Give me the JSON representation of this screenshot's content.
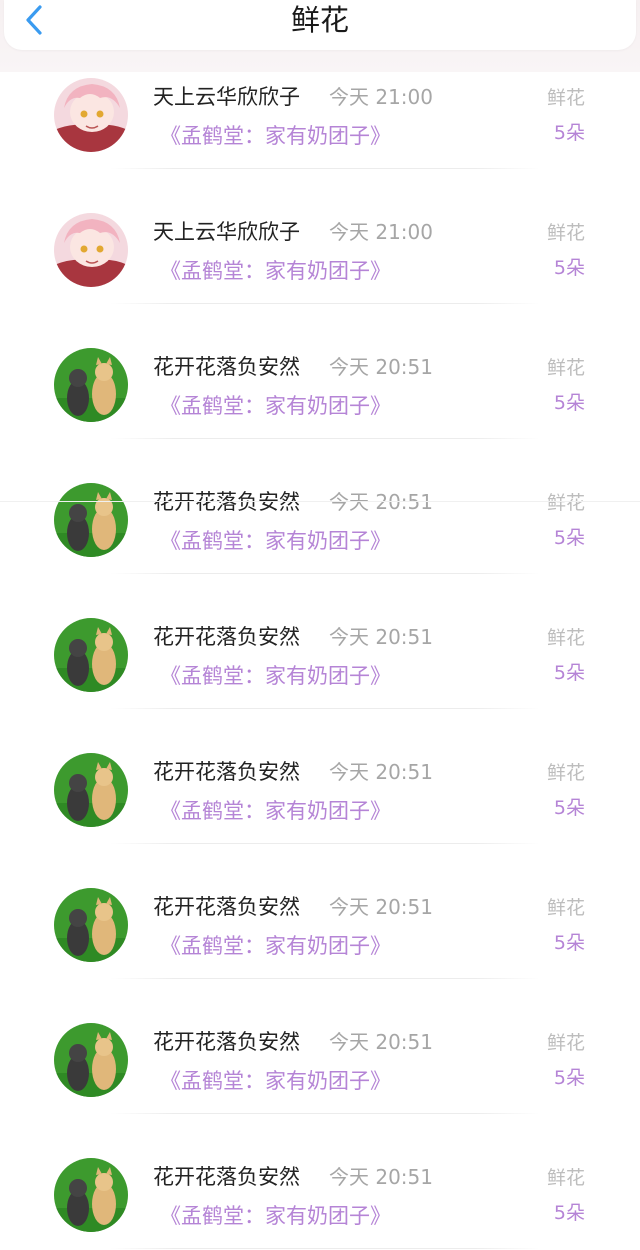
{
  "header": {
    "title": "鲜花",
    "back_icon": "chevron-left-icon",
    "accent_color": "#3a9bf0"
  },
  "colors": {
    "purple": "#b584d6",
    "gray": "#a6a6a6",
    "text": "#222222"
  },
  "records": [
    {
      "avatar": "anime-girl-avatar",
      "username": "天上云华欣欣子",
      "time": "今天 21:00",
      "book": "《孟鹤堂：家有奶团子》",
      "gift_type": "鲜花",
      "gift_count": "5朵"
    },
    {
      "avatar": "anime-girl-avatar",
      "username": "天上云华欣欣子",
      "time": "今天 21:00",
      "book": "《孟鹤堂：家有奶团子》",
      "gift_type": "鲜花",
      "gift_count": "5朵"
    },
    {
      "avatar": "cats-avatar",
      "username": "花开花落负安然",
      "time": "今天 20:51",
      "book": "《孟鹤堂：家有奶团子》",
      "gift_type": "鲜花",
      "gift_count": "5朵"
    },
    {
      "avatar": "cats-avatar",
      "username": "花开花落负安然",
      "time": "今天 20:51",
      "book": "《孟鹤堂：家有奶团子》",
      "gift_type": "鲜花",
      "gift_count": "5朵"
    },
    {
      "avatar": "cats-avatar",
      "username": "花开花落负安然",
      "time": "今天 20:51",
      "book": "《孟鹤堂：家有奶团子》",
      "gift_type": "鲜花",
      "gift_count": "5朵"
    },
    {
      "avatar": "cats-avatar",
      "username": "花开花落负安然",
      "time": "今天 20:51",
      "book": "《孟鹤堂：家有奶团子》",
      "gift_type": "鲜花",
      "gift_count": "5朵"
    },
    {
      "avatar": "cats-avatar",
      "username": "花开花落负安然",
      "time": "今天 20:51",
      "book": "《孟鹤堂：家有奶团子》",
      "gift_type": "鲜花",
      "gift_count": "5朵"
    },
    {
      "avatar": "cats-avatar",
      "username": "花开花落负安然",
      "time": "今天 20:51",
      "book": "《孟鹤堂：家有奶团子》",
      "gift_type": "鲜花",
      "gift_count": "5朵"
    },
    {
      "avatar": "cats-avatar",
      "username": "花开花落负安然",
      "time": "今天 20:51",
      "book": "《孟鹤堂：家有奶团子》",
      "gift_type": "鲜花",
      "gift_count": "5朵"
    }
  ]
}
